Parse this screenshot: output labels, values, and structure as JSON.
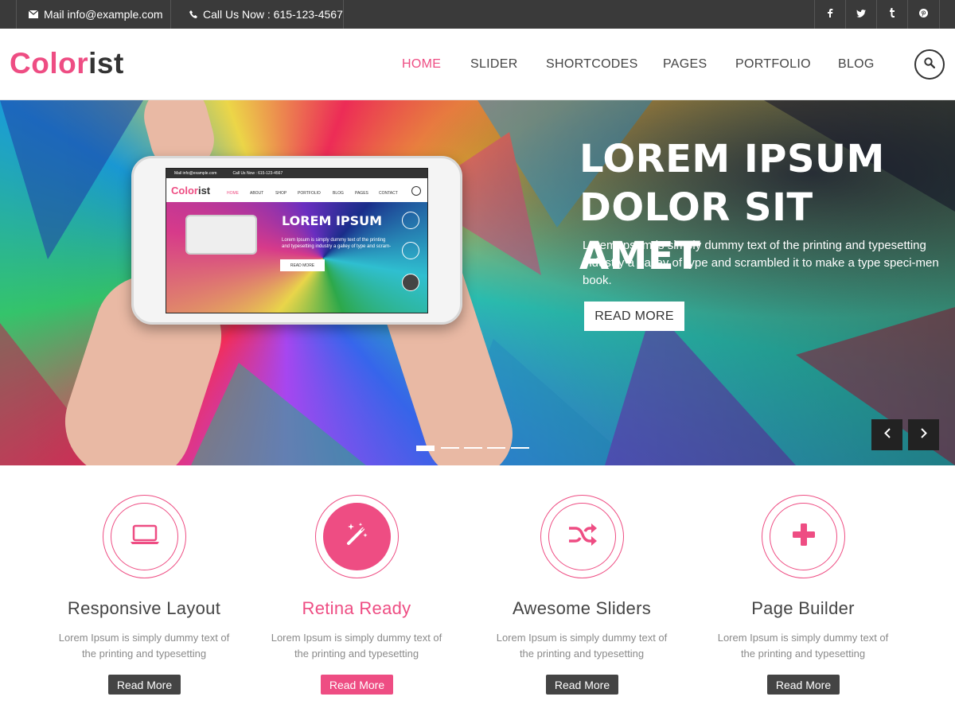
{
  "topbar": {
    "mail": "Mail info@example.com",
    "phone": "Call Us Now : 615-123-4567",
    "social": [
      {
        "icon": "facebook-icon",
        "glyph": "f"
      },
      {
        "icon": "twitter-icon",
        "glyph": "t"
      },
      {
        "icon": "tumblr-icon",
        "glyph": "t"
      },
      {
        "icon": "pinterest-icon",
        "glyph": "p"
      }
    ]
  },
  "header": {
    "logo_part1": "Color",
    "logo_part2": "ist",
    "nav": [
      "HOME",
      "SLIDER",
      "SHORTCODES",
      "PAGES",
      "PORTFOLIO",
      "BLOG"
    ],
    "active_nav": "HOME"
  },
  "hero": {
    "title_line1": "LOREM IPSUM",
    "title_line2": "DOLOR SIT AMET",
    "text": "Lorem Ipsum is simply dummy text of the printing and typesetting industry a galley of type and scrambled it to make a type speci-men book.",
    "button": "READ MORE",
    "slides": 5,
    "active_slide": 1
  },
  "phone_screen": {
    "mail": "Mail info@example.com",
    "phone": "Call Us Now : 615-123-4567",
    "logo_part1": "Color",
    "logo_part2": "ist",
    "nav": [
      "HOME",
      "ABOUT",
      "SHOP",
      "PORTFOLIO",
      "BLOG",
      "PAGES",
      "CONTACT"
    ],
    "title": "LOREM IPSUM",
    "text": "Lorem Ipsum is simply dummy text of the printing and typesetting industry a galley of type and scram-",
    "button": "READ MORE"
  },
  "features": [
    {
      "title": "Responsive Layout",
      "text": "Lorem Ipsum is simply dummy text of the printing and typesetting",
      "button": "Read More",
      "icon": "laptop-icon"
    },
    {
      "title": "Retina Ready",
      "text": "Lorem Ipsum is simply dummy text of the printing and typesetting",
      "button": "Read More",
      "icon": "magic-wand-icon"
    },
    {
      "title": "Awesome Sliders",
      "text": "Lorem Ipsum is simply dummy text of the printing and typesetting",
      "button": "Read More",
      "icon": "shuffle-icon"
    },
    {
      "title": "Page Builder",
      "text": "Lorem Ipsum is simply dummy text of the printing and typesetting",
      "button": "Read More",
      "icon": "plus-icon"
    }
  ],
  "colors": {
    "accent": "#ee4d83",
    "topbar": "#3a3a3a",
    "text": "#444444"
  }
}
